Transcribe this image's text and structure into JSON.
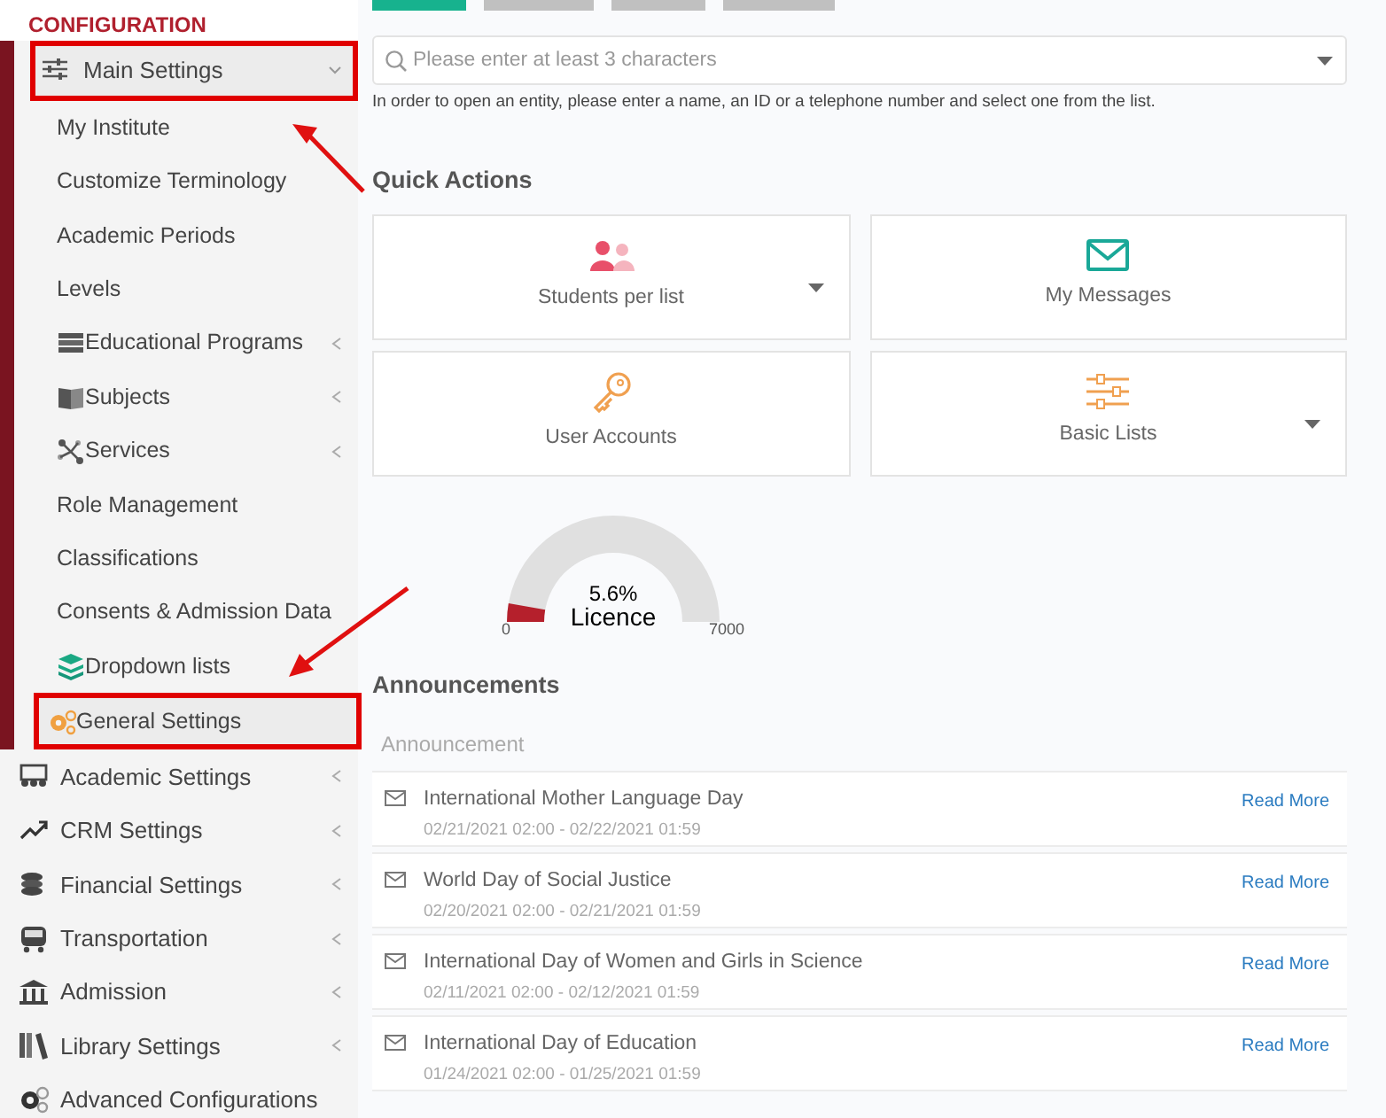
{
  "sidebar": {
    "section_title": "CONFIGURATION",
    "items": [
      {
        "label": "Main Settings",
        "submenu": true,
        "expanded": true,
        "highlighted": true,
        "children": [
          {
            "label": "My Institute",
            "submenu": false,
            "highlighted": false
          },
          {
            "label": "Customize Terminology",
            "submenu": false,
            "highlighted": false
          },
          {
            "label": "Academic Periods",
            "submenu": false,
            "highlighted": false
          },
          {
            "label": "Levels",
            "submenu": false,
            "highlighted": false
          },
          {
            "label": "Educational Programs",
            "submenu": true,
            "highlighted": false
          },
          {
            "label": "Subjects",
            "submenu": true,
            "highlighted": false
          },
          {
            "label": "Services",
            "submenu": true,
            "highlighted": false
          },
          {
            "label": "Role Management",
            "submenu": false,
            "highlighted": false
          },
          {
            "label": "Classifications",
            "submenu": false,
            "highlighted": false
          },
          {
            "label": "Consents & Admission Data",
            "submenu": false,
            "highlighted": false
          },
          {
            "label": "Dropdown lists",
            "submenu": false,
            "highlighted": false
          },
          {
            "label": "General Settings",
            "submenu": false,
            "highlighted": true
          }
        ]
      },
      {
        "label": "Academic Settings",
        "submenu": true,
        "expanded": false,
        "highlighted": false
      },
      {
        "label": "CRM Settings",
        "submenu": true,
        "expanded": false,
        "highlighted": false
      },
      {
        "label": "Financial Settings",
        "submenu": true,
        "expanded": false,
        "highlighted": false
      },
      {
        "label": "Transportation",
        "submenu": true,
        "expanded": false,
        "highlighted": false
      },
      {
        "label": "Admission",
        "submenu": true,
        "expanded": false,
        "highlighted": false
      },
      {
        "label": "Library Settings",
        "submenu": true,
        "expanded": false,
        "highlighted": false
      },
      {
        "label": "Advanced Configurations",
        "submenu": false,
        "expanded": false,
        "highlighted": false
      }
    ]
  },
  "top_tabs": [
    {
      "selected": true
    },
    {
      "selected": false
    },
    {
      "selected": false
    },
    {
      "selected": false
    }
  ],
  "search": {
    "placeholder": "Please enter at least 3 characters",
    "hint": "In order to open an entity, please enter a name, an ID or a telephone number and select one from the list."
  },
  "quick_actions": {
    "title": "Quick Actions",
    "cards": [
      {
        "label": "Students per list",
        "dropdown": true
      },
      {
        "label": "My Messages",
        "dropdown": false
      },
      {
        "label": "User Accounts",
        "dropdown": false
      },
      {
        "label": "Basic Lists",
        "dropdown": true
      }
    ]
  },
  "licence_gauge": {
    "level": 0.056,
    "reading": "5.6%",
    "label": "Licence",
    "min": "0",
    "max": "7000"
  },
  "announcements": {
    "title": "Announcements",
    "column_header": "Announcement",
    "rows": [
      {
        "title": "International Mother Language Day",
        "dates": "02/21/2021 02:00 - 02/22/2021 01:59",
        "link": "Read More"
      },
      {
        "title": "World Day of Social Justice",
        "dates": "02/20/2021 02:00 - 02/21/2021 01:59",
        "link": "Read More"
      },
      {
        "title": "International Day of Women and Girls in Science",
        "dates": "02/11/2021 02:00 - 02/12/2021 01:59",
        "link": "Read More"
      },
      {
        "title": "International Day of Education",
        "dates": "01/24/2021 02:00 - 01/25/2021 01:59",
        "link": "Read More"
      }
    ]
  }
}
